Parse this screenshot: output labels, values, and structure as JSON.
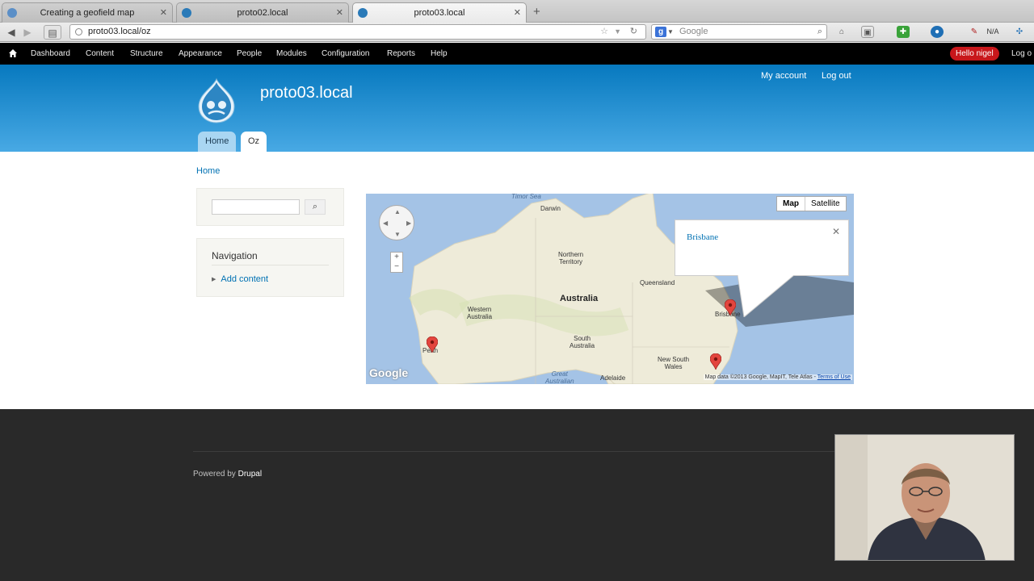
{
  "browser": {
    "tabs": [
      {
        "title": "Creating a geofield map",
        "active": false
      },
      {
        "title": "proto02.local",
        "active": false
      },
      {
        "title": "proto03.local",
        "active": true
      }
    ],
    "url": "proto03.local/oz",
    "search_placeholder": "Google",
    "toolbar_extra": "N/A"
  },
  "admin_toolbar": {
    "items": [
      "Dashboard",
      "Content",
      "Structure",
      "Appearance",
      "People",
      "Modules",
      "Configuration",
      "Reports",
      "Help"
    ],
    "greeting": "Hello nigel",
    "logout": "Log o"
  },
  "site": {
    "name": "proto03.local",
    "secondary_links": [
      "My account",
      "Log out"
    ],
    "main_tabs": [
      {
        "label": "Home",
        "active": false
      },
      {
        "label": "Oz",
        "active": true
      }
    ]
  },
  "breadcrumb": "Home",
  "sidebar": {
    "search_button": "⌕",
    "navigation_title": "Navigation",
    "navigation_items": [
      "Add content"
    ]
  },
  "map": {
    "type_buttons": [
      "Map",
      "Satellite"
    ],
    "infowindow_title": "Brisbane",
    "labels": {
      "timor_sea": "Timor Sea",
      "darwin": "Darwin",
      "northern_territory": "Northern\nTerritory",
      "queensland": "Queensland",
      "western_australia": "Western\nAustralia",
      "australia": "Australia",
      "south_australia": "South\nAustralia",
      "new_south_wales": "New South\nWales",
      "great_australian": "Great\nAustralian",
      "adelaide": "Adelaide",
      "brisbane_map": "Brisbane",
      "perth_map": "Perth"
    },
    "google_logo": "Google",
    "attribution": "Map data ©2013 Google, MapIT, Tele Atlas - ",
    "terms": "Terms of Use",
    "zoom_in": "+",
    "zoom_out": "−"
  },
  "footer": {
    "powered_prefix": "Powered by ",
    "powered_link": "Drupal"
  },
  "colors": {
    "header_top": "#0779bf",
    "header_bottom": "#48a9e4",
    "link": "#0071b3",
    "toolbar_bg": "#000000",
    "hello_badge": "#c8171b",
    "footer_bg": "#292929",
    "map_water": "#a4c3e6",
    "map_land": "#eeebd9",
    "marker": "#e3453e"
  }
}
